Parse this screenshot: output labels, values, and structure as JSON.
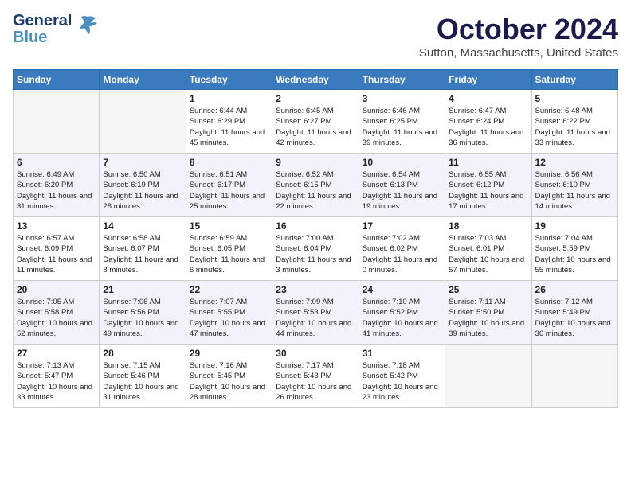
{
  "header": {
    "logo_general": "General",
    "logo_blue": "Blue",
    "month": "October 2024",
    "location": "Sutton, Massachusetts, United States"
  },
  "weekdays": [
    "Sunday",
    "Monday",
    "Tuesday",
    "Wednesday",
    "Thursday",
    "Friday",
    "Saturday"
  ],
  "weeks": [
    [
      {
        "day": "",
        "info": ""
      },
      {
        "day": "",
        "info": ""
      },
      {
        "day": "1",
        "info": "Sunrise: 6:44 AM\nSunset: 6:29 PM\nDaylight: 11 hours and 45 minutes."
      },
      {
        "day": "2",
        "info": "Sunrise: 6:45 AM\nSunset: 6:27 PM\nDaylight: 11 hours and 42 minutes."
      },
      {
        "day": "3",
        "info": "Sunrise: 6:46 AM\nSunset: 6:25 PM\nDaylight: 11 hours and 39 minutes."
      },
      {
        "day": "4",
        "info": "Sunrise: 6:47 AM\nSunset: 6:24 PM\nDaylight: 11 hours and 36 minutes."
      },
      {
        "day": "5",
        "info": "Sunrise: 6:48 AM\nSunset: 6:22 PM\nDaylight: 11 hours and 33 minutes."
      }
    ],
    [
      {
        "day": "6",
        "info": "Sunrise: 6:49 AM\nSunset: 6:20 PM\nDaylight: 11 hours and 31 minutes."
      },
      {
        "day": "7",
        "info": "Sunrise: 6:50 AM\nSunset: 6:19 PM\nDaylight: 11 hours and 28 minutes."
      },
      {
        "day": "8",
        "info": "Sunrise: 6:51 AM\nSunset: 6:17 PM\nDaylight: 11 hours and 25 minutes."
      },
      {
        "day": "9",
        "info": "Sunrise: 6:52 AM\nSunset: 6:15 PM\nDaylight: 11 hours and 22 minutes."
      },
      {
        "day": "10",
        "info": "Sunrise: 6:54 AM\nSunset: 6:13 PM\nDaylight: 11 hours and 19 minutes."
      },
      {
        "day": "11",
        "info": "Sunrise: 6:55 AM\nSunset: 6:12 PM\nDaylight: 11 hours and 17 minutes."
      },
      {
        "day": "12",
        "info": "Sunrise: 6:56 AM\nSunset: 6:10 PM\nDaylight: 11 hours and 14 minutes."
      }
    ],
    [
      {
        "day": "13",
        "info": "Sunrise: 6:57 AM\nSunset: 6:09 PM\nDaylight: 11 hours and 11 minutes."
      },
      {
        "day": "14",
        "info": "Sunrise: 6:58 AM\nSunset: 6:07 PM\nDaylight: 11 hours and 8 minutes."
      },
      {
        "day": "15",
        "info": "Sunrise: 6:59 AM\nSunset: 6:05 PM\nDaylight: 11 hours and 6 minutes."
      },
      {
        "day": "16",
        "info": "Sunrise: 7:00 AM\nSunset: 6:04 PM\nDaylight: 11 hours and 3 minutes."
      },
      {
        "day": "17",
        "info": "Sunrise: 7:02 AM\nSunset: 6:02 PM\nDaylight: 11 hours and 0 minutes."
      },
      {
        "day": "18",
        "info": "Sunrise: 7:03 AM\nSunset: 6:01 PM\nDaylight: 10 hours and 57 minutes."
      },
      {
        "day": "19",
        "info": "Sunrise: 7:04 AM\nSunset: 5:59 PM\nDaylight: 10 hours and 55 minutes."
      }
    ],
    [
      {
        "day": "20",
        "info": "Sunrise: 7:05 AM\nSunset: 5:58 PM\nDaylight: 10 hours and 52 minutes."
      },
      {
        "day": "21",
        "info": "Sunrise: 7:06 AM\nSunset: 5:56 PM\nDaylight: 10 hours and 49 minutes."
      },
      {
        "day": "22",
        "info": "Sunrise: 7:07 AM\nSunset: 5:55 PM\nDaylight: 10 hours and 47 minutes."
      },
      {
        "day": "23",
        "info": "Sunrise: 7:09 AM\nSunset: 5:53 PM\nDaylight: 10 hours and 44 minutes."
      },
      {
        "day": "24",
        "info": "Sunrise: 7:10 AM\nSunset: 5:52 PM\nDaylight: 10 hours and 41 minutes."
      },
      {
        "day": "25",
        "info": "Sunrise: 7:11 AM\nSunset: 5:50 PM\nDaylight: 10 hours and 39 minutes."
      },
      {
        "day": "26",
        "info": "Sunrise: 7:12 AM\nSunset: 5:49 PM\nDaylight: 10 hours and 36 minutes."
      }
    ],
    [
      {
        "day": "27",
        "info": "Sunrise: 7:13 AM\nSunset: 5:47 PM\nDaylight: 10 hours and 33 minutes."
      },
      {
        "day": "28",
        "info": "Sunrise: 7:15 AM\nSunset: 5:46 PM\nDaylight: 10 hours and 31 minutes."
      },
      {
        "day": "29",
        "info": "Sunrise: 7:16 AM\nSunset: 5:45 PM\nDaylight: 10 hours and 28 minutes."
      },
      {
        "day": "30",
        "info": "Sunrise: 7:17 AM\nSunset: 5:43 PM\nDaylight: 10 hours and 26 minutes."
      },
      {
        "day": "31",
        "info": "Sunrise: 7:18 AM\nSunset: 5:42 PM\nDaylight: 10 hours and 23 minutes."
      },
      {
        "day": "",
        "info": ""
      },
      {
        "day": "",
        "info": ""
      }
    ]
  ]
}
